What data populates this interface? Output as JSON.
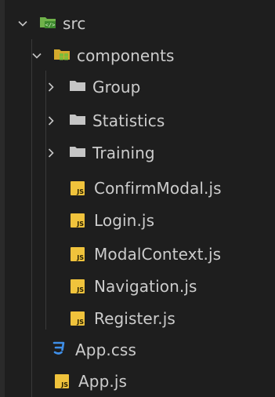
{
  "tree": {
    "src": {
      "label": "src",
      "icon": "src-folder-icon",
      "expanded": true
    },
    "components": {
      "label": "components",
      "icon": "components-folder-icon",
      "expanded": true
    },
    "folders": [
      {
        "label": "Group",
        "icon": "folder-icon",
        "expanded": false
      },
      {
        "label": "Statistics",
        "icon": "folder-icon",
        "expanded": false
      },
      {
        "label": "Training",
        "icon": "folder-icon",
        "expanded": false
      }
    ],
    "component_files": [
      {
        "label": "ConfirmModal.js",
        "icon": "js-file-icon"
      },
      {
        "label": "Login.js",
        "icon": "js-file-icon"
      },
      {
        "label": "ModalContext.js",
        "icon": "js-file-icon"
      },
      {
        "label": "Navigation.js",
        "icon": "js-file-icon"
      },
      {
        "label": "Register.js",
        "icon": "js-file-icon"
      }
    ],
    "src_files": [
      {
        "label": "App.css",
        "icon": "css-file-icon"
      },
      {
        "label": "App.js",
        "icon": "js-file-icon"
      }
    ]
  },
  "colors": {
    "background": "#1e1e1e",
    "text": "#cccccc",
    "js_icon": "#f0c33c",
    "css_icon": "#3f8fe8",
    "folder_gray": "#c5c5c5",
    "src_folder_green": "#6fb24a",
    "components_folder_yellow": "#d4aa2c"
  }
}
